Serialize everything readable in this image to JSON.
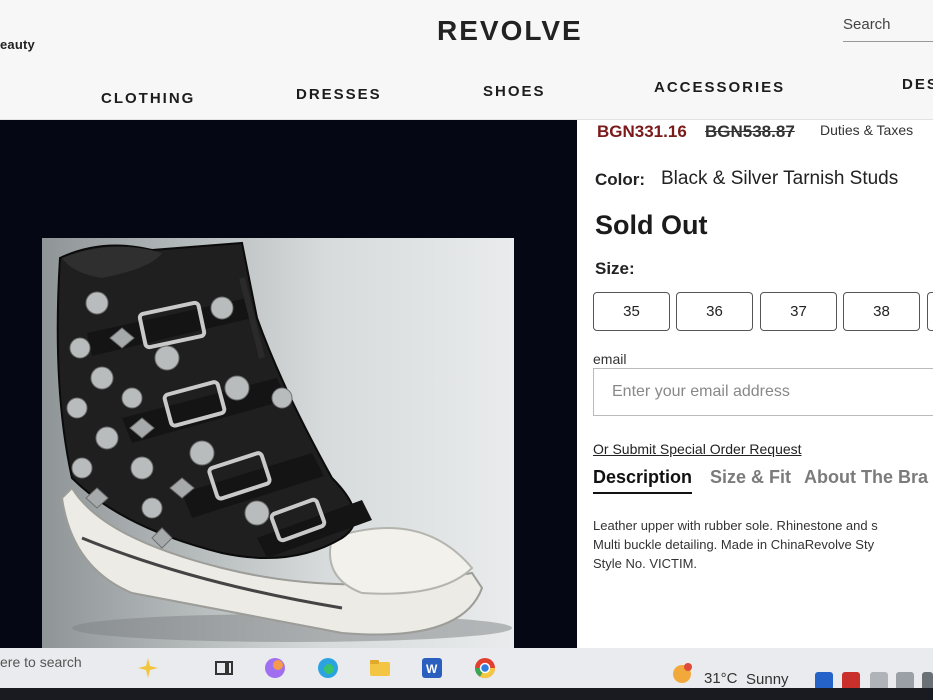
{
  "header": {
    "beauty_link": "eauty",
    "logo": "REVOLVE",
    "search_placeholder": "Search",
    "nav": [
      "CLOTHING",
      "DRESSES",
      "SHOES",
      "ACCESSORIES",
      "DES"
    ]
  },
  "product": {
    "price_sale": "BGN331.16",
    "price_original": "BGN538.87",
    "duties": "Duties & Taxes",
    "color_label": "Color:",
    "color_value": "Black & Silver Tarnish Studs",
    "status": "Sold Out",
    "size_label": "Size:",
    "sizes": [
      "35",
      "36",
      "37",
      "38"
    ],
    "email_label": "email",
    "email_placeholder": "Enter your email address",
    "special_order": "Or Submit Special Order Request",
    "tabs": [
      "Description",
      "Size & Fit",
      "About The Bra"
    ],
    "description_lines": [
      "Leather upper with rubber sole. Rhinestone and s",
      "Multi buckle detailing. Made in ChinaRevolve Sty",
      "Style No. VICTIM."
    ]
  },
  "taskbar": {
    "search_text": "ere to search",
    "temperature": "31°C",
    "weather": "Sunny",
    "icons": [
      "copilot-icon",
      "task-view-icon",
      "copilot-app-icon",
      "edge-icon",
      "file-explorer-icon",
      "word-icon",
      "chrome-icon"
    ]
  },
  "colors": {
    "sale_price": "#7a1a1a",
    "image_background": "#050814",
    "taskbar": "#e9ebee"
  }
}
